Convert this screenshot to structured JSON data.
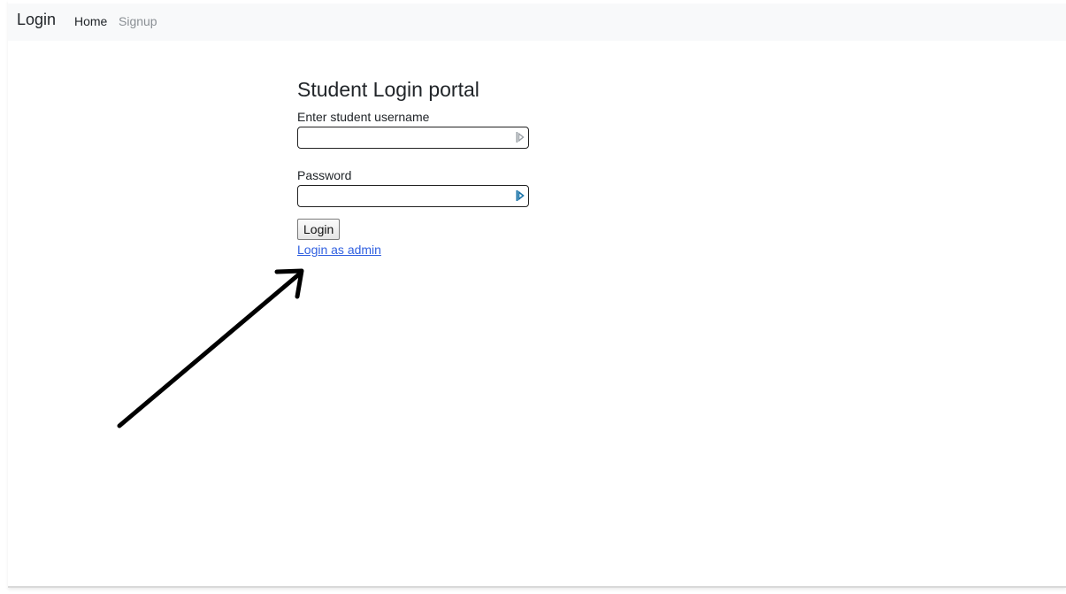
{
  "navbar": {
    "brand": "Login",
    "links": [
      {
        "label": "Home"
      },
      {
        "label": "Signup"
      }
    ]
  },
  "form": {
    "title": "Student Login portal",
    "username_label": "Enter student username",
    "username_value": "",
    "password_label": "Password",
    "password_value": "",
    "login_button": "Login",
    "admin_link": "Login as admin"
  },
  "colors": {
    "navbar_bg": "#f8f9fa",
    "link": "#2f5fe0",
    "muted_nav": "#8a8f94",
    "autofill_icon_active": "#1a73a8",
    "autofill_icon_idle": "#9aa0a6"
  },
  "icons": {
    "username_field": "autofill-key-icon",
    "password_field": "autofill-key-icon",
    "annotation": "arrow-icon"
  }
}
